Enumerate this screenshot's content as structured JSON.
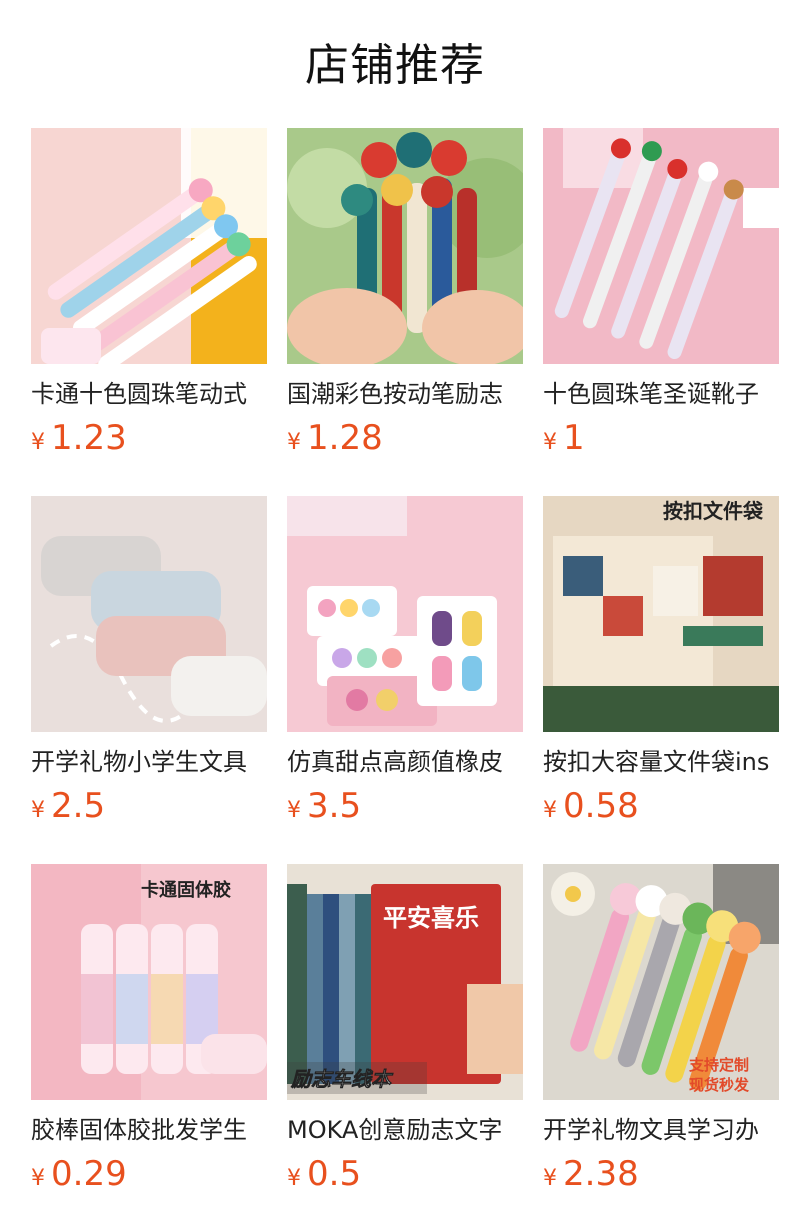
{
  "page": {
    "title": "店铺推荐"
  },
  "currency_symbol": "¥",
  "colors": {
    "price": "#e8501e",
    "text": "#222222"
  },
  "products": [
    {
      "name": "卡通十色圆珠笔动式",
      "price": "1.23",
      "image": "multicolor-pens-cartoon"
    },
    {
      "name": "国潮彩色按动笔励志",
      "price": "1.28",
      "image": "guochao-pens-in-hand"
    },
    {
      "name": "十色圆珠笔圣诞靴子",
      "price": "1",
      "image": "christmas-pens"
    },
    {
      "name": "开学礼物小学生文具",
      "price": "2.5",
      "image": "pencil-cases"
    },
    {
      "name": "仿真甜点高颜值橡皮",
      "price": "3.5",
      "image": "dessert-erasers"
    },
    {
      "name": "按扣大容量文件袋ins",
      "price": "0.58",
      "image": "file-bags"
    },
    {
      "name": "胶棒固体胶批发学生",
      "price": "0.29",
      "image": "glue-sticks"
    },
    {
      "name": "MOKA创意励志文字",
      "price": "0.5",
      "image": "motivational-notebooks"
    },
    {
      "name": "开学礼物文具学习办",
      "price": "2.38",
      "image": "squishy-pens"
    }
  ],
  "image_text": {
    "file_bags_banner": "按扣文件袋",
    "glue_banner": "卡通固体胶",
    "notebook_banner": "励志车线本",
    "notebook_cover": "平安喜乐",
    "squishy_banner_1": "支持定制",
    "squishy_banner_2": "现货秒发"
  }
}
